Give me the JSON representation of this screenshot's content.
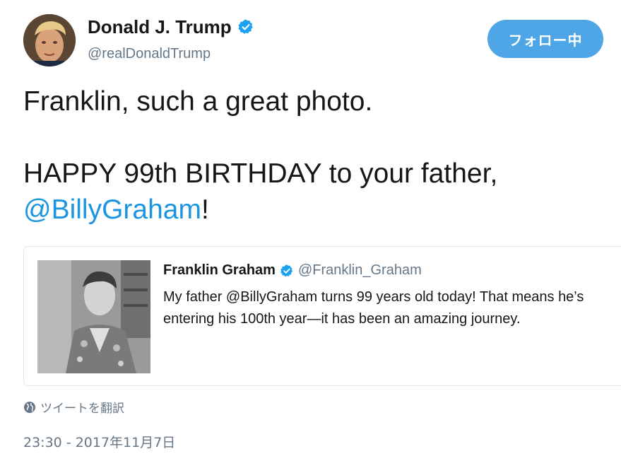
{
  "author": {
    "display_name": "Donald J. Trump",
    "handle": "@realDonaldTrump",
    "verified_icon": "verified-badge-icon"
  },
  "follow_button": {
    "label": "フォロー中"
  },
  "tweet": {
    "line1": "Franklin, such a great photo.",
    "line2_prefix": "HAPPY 99th BIRTHDAY to your father,",
    "mention": "@BillyGraham",
    "line3_suffix": "!"
  },
  "quoted_tweet": {
    "display_name": "Franklin Graham",
    "handle": "@Franklin_Graham",
    "text_line1": "My father @BillyGraham turns 99 years old today! That means he’s",
    "text_line2": "entering his 100th year—it has been an amazing journey."
  },
  "translate": {
    "label": "ツイートを翻訳",
    "icon": "globe-icon"
  },
  "timestamp": "23:30 - 2017年11月7日",
  "colors": {
    "accent": "#1b95e0",
    "follow_button_bg": "#4ea6e6",
    "secondary_text": "#657786"
  }
}
